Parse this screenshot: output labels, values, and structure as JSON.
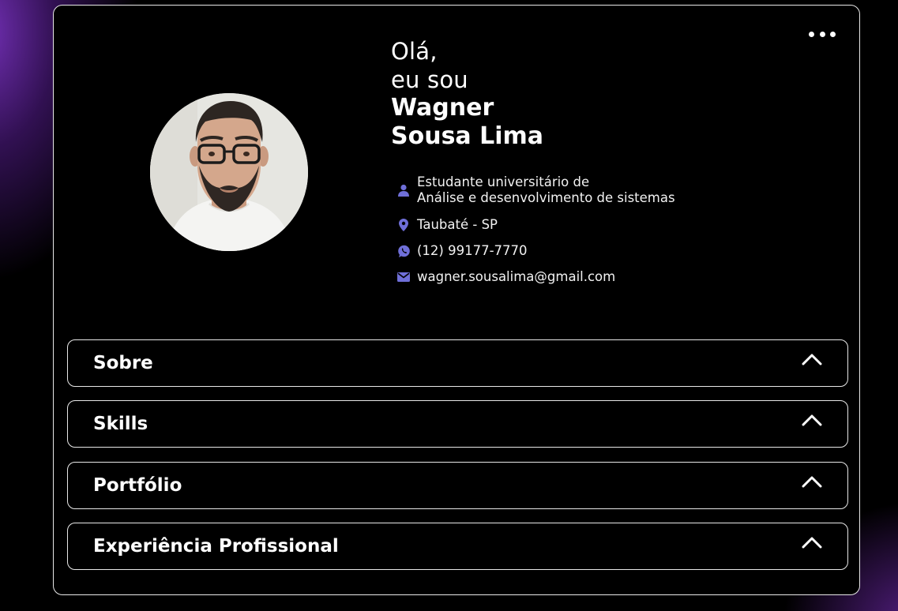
{
  "header": {
    "greeting_line1": "Olá,",
    "greeting_line2": "eu sou",
    "name_line1": "Wagner",
    "name_line2": "Sousa Lima",
    "menu_icon": "more-horizontal-icon"
  },
  "profile": {
    "role_line1": "Estudante universitário de",
    "role_line2": "Análise e desenvolvimento de sistemas",
    "location": "Taubaté - SP",
    "phone": "(12) 99177-7770",
    "email": "wagner.sousalima@gmail.com",
    "icons": [
      "user-icon",
      "location-pin-icon",
      "whatsapp-icon",
      "mail-icon"
    ],
    "icon_color": "#6f6fd8"
  },
  "sections": [
    {
      "label": "Sobre"
    },
    {
      "label": "Skills"
    },
    {
      "label": "Portfólio"
    },
    {
      "label": "Experiência Profissional"
    }
  ],
  "colors": {
    "background": "#000000",
    "border": "#e8e8e8",
    "text": "#ffffff",
    "accent_glow": "#7832be"
  }
}
